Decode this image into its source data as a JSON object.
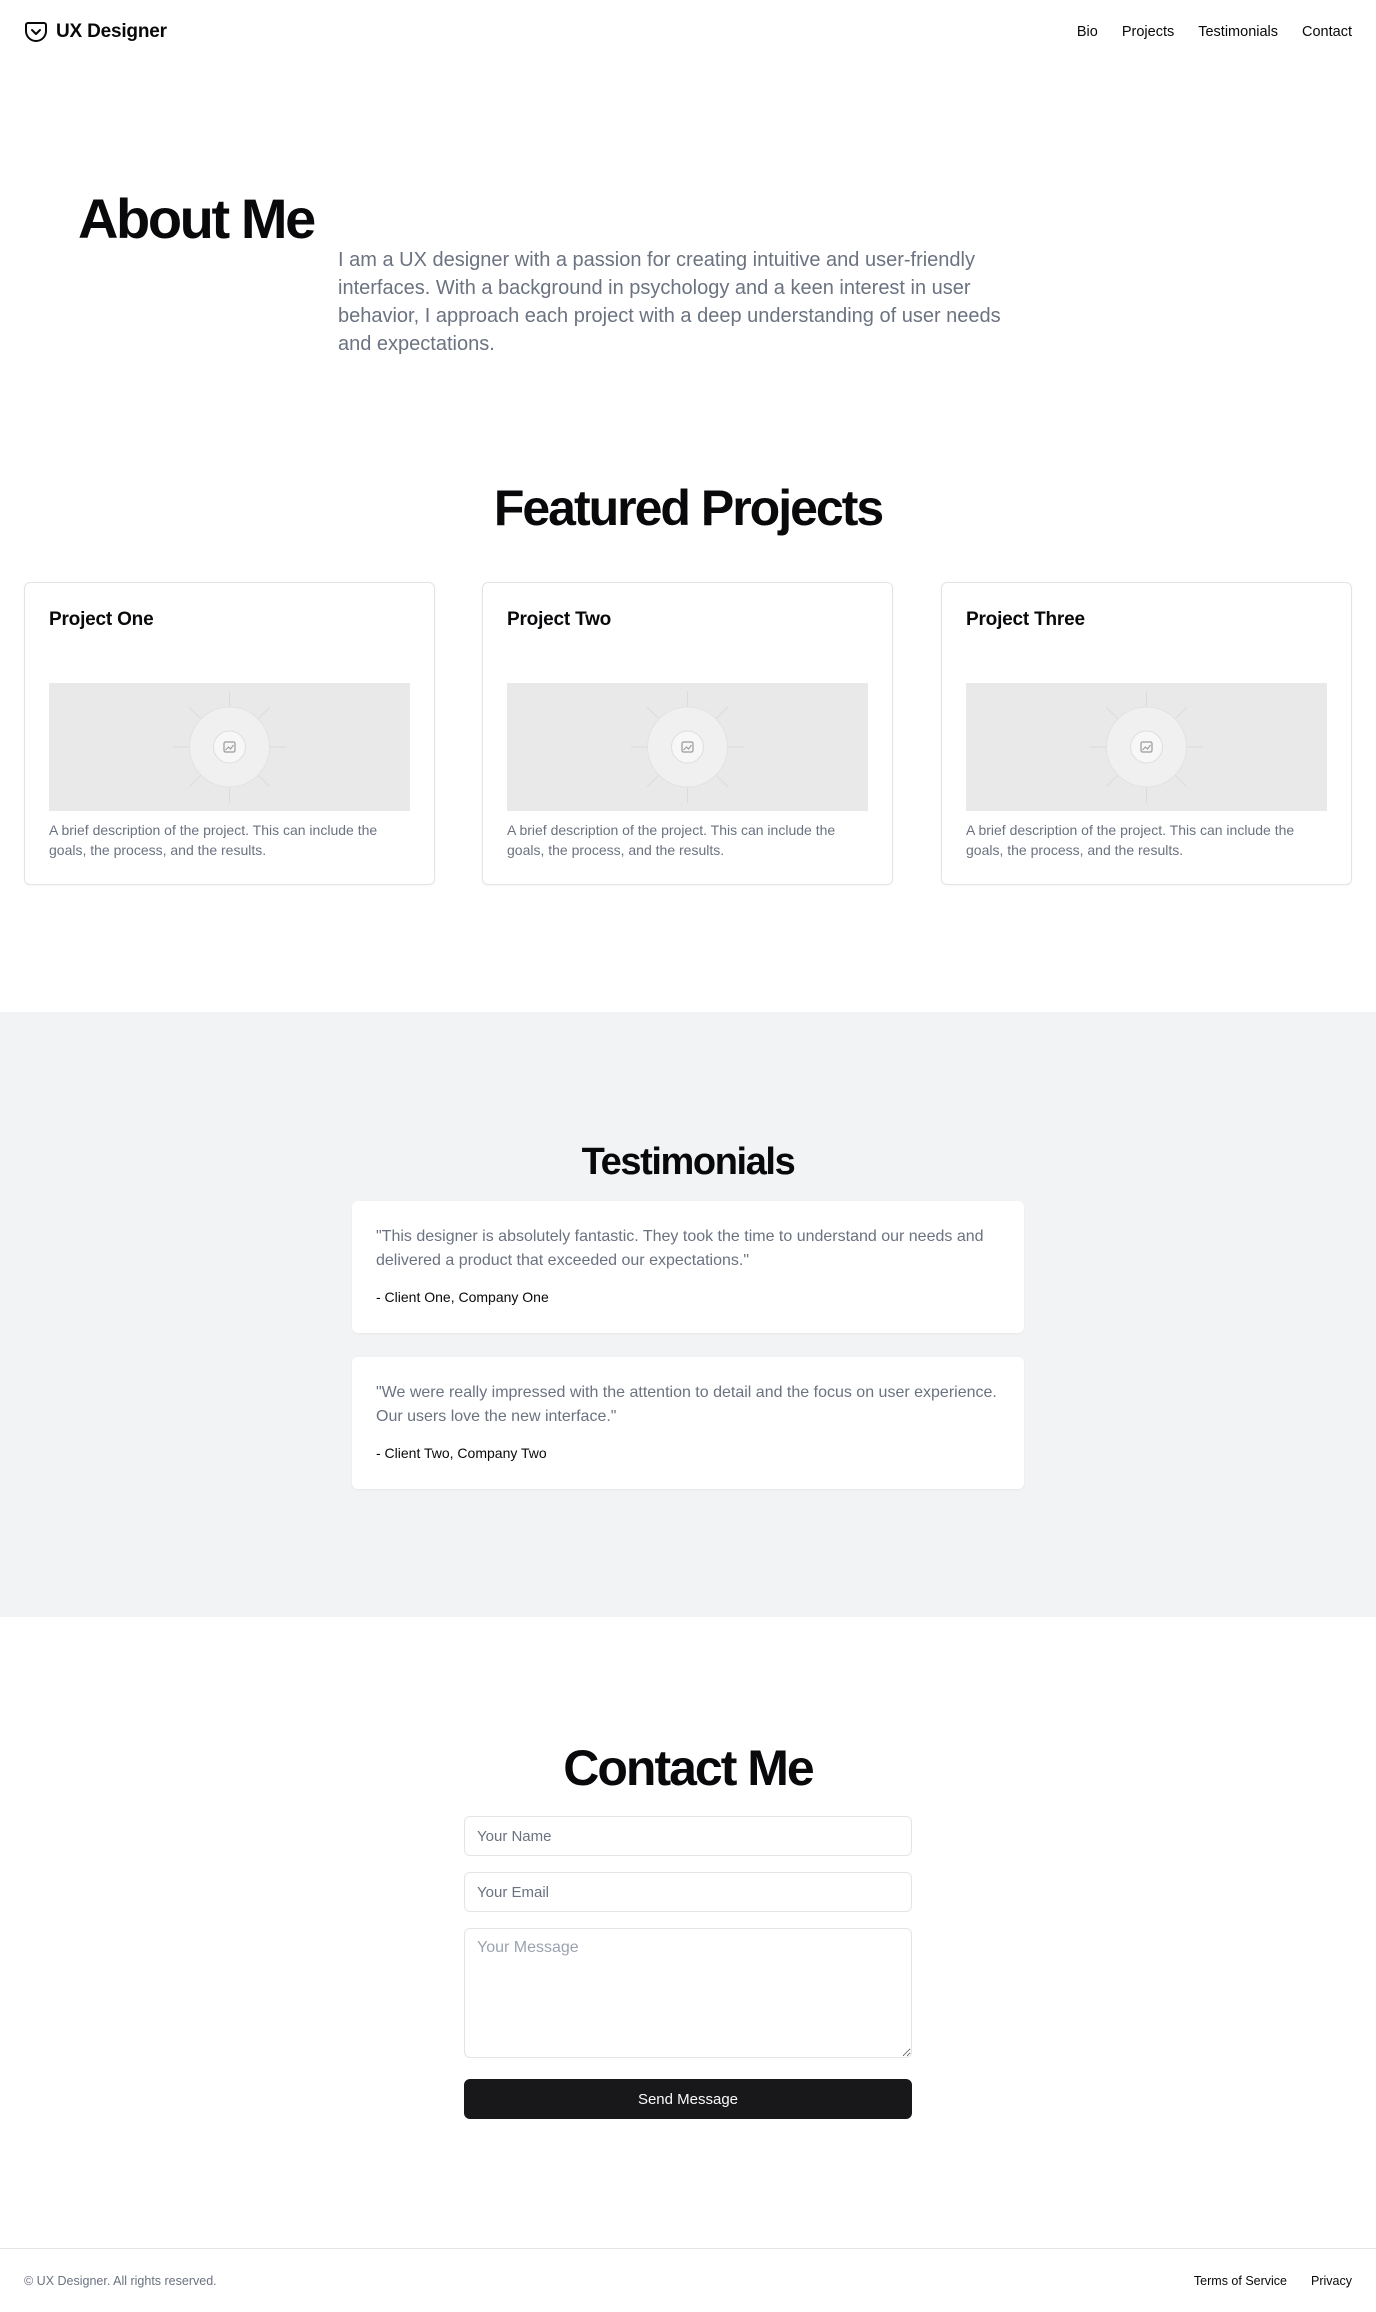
{
  "header": {
    "brand": "UX Designer",
    "brand_icon": "pocket-icon",
    "nav": [
      {
        "label": "Bio"
      },
      {
        "label": "Projects"
      },
      {
        "label": "Testimonials"
      },
      {
        "label": "Contact"
      }
    ]
  },
  "about": {
    "title": "About Me",
    "text": "I am a UX designer with a passion for creating intuitive and user-friendly interfaces. With a background in psychology and a keen interest in user behavior, I approach each project with a deep understanding of user needs and expectations."
  },
  "projects": {
    "title": "Featured Projects",
    "items": [
      {
        "title": "Project One",
        "image_icon": "image-placeholder-icon",
        "description": "A brief description of the project. This can include the goals, the process, and the results."
      },
      {
        "title": "Project Two",
        "image_icon": "image-placeholder-icon",
        "description": "A brief description of the project. This can include the goals, the process, and the results."
      },
      {
        "title": "Project Three",
        "image_icon": "image-placeholder-icon",
        "description": "A brief description of the project. This can include the goals, the process, and the results."
      }
    ]
  },
  "testimonials": {
    "title": "Testimonials",
    "items": [
      {
        "quote": "\"This designer is absolutely fantastic. They took the time to understand our needs and delivered a product that exceeded our expectations.\"",
        "author": "- Client One, Company One"
      },
      {
        "quote": "\"We were really impressed with the attention to detail and the focus on user experience. Our users love the new interface.\"",
        "author": "- Client Two, Company Two"
      }
    ]
  },
  "contact": {
    "title": "Contact Me",
    "name_placeholder": "Your Name",
    "email_placeholder": "Your Email",
    "message_placeholder": "Your Message",
    "submit_label": "Send Message"
  },
  "footer": {
    "copyright": "© UX Designer. All rights reserved.",
    "links": [
      {
        "label": "Terms of Service"
      },
      {
        "label": "Privacy"
      }
    ]
  },
  "colors": {
    "text": "#09090b",
    "muted": "#6b7280",
    "section_bg": "#f2f3f5",
    "button_bg": "#18181b",
    "border": "#e4e4e7",
    "placeholder_bg": "#e9e9e9"
  }
}
